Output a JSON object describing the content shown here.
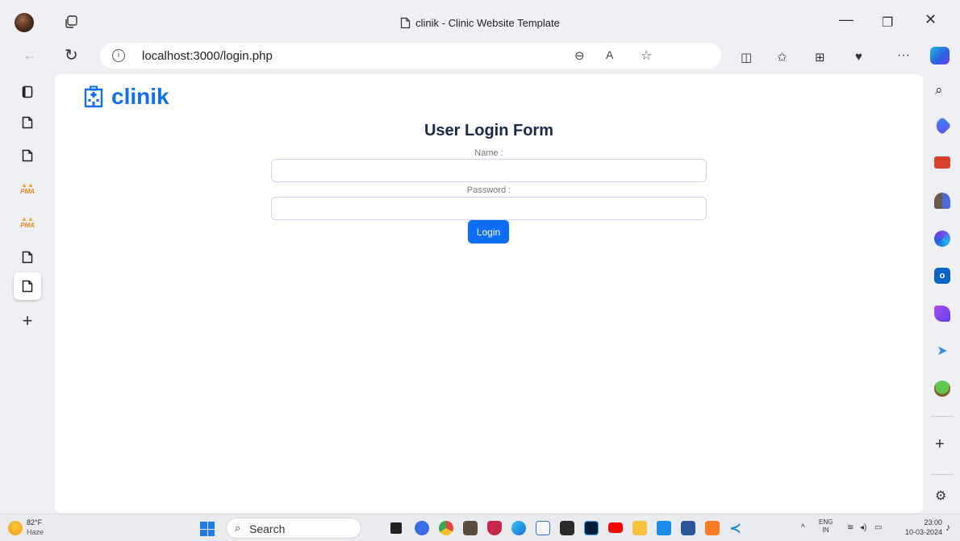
{
  "window": {
    "title": "clinik - Clinic Website Template"
  },
  "address_bar": {
    "url": "localhost:3000/login.php"
  },
  "page": {
    "brand": "clinik",
    "form_title": "User Login Form",
    "name_label": "Name :",
    "password_label": "Password :",
    "name_value": "",
    "password_value": "",
    "login_button": "Login"
  },
  "vertical_tabs": [
    {
      "icon": "page-icon"
    },
    {
      "icon": "page-icon"
    },
    {
      "icon": "phpmyadmin-icon",
      "label": "PMA"
    },
    {
      "icon": "phpmyadmin-icon",
      "label": "PMA"
    },
    {
      "icon": "page-icon"
    },
    {
      "icon": "page-icon",
      "active": true
    }
  ],
  "taskbar": {
    "weather_temp": "82°F",
    "weather_condition": "Haze",
    "search_label": "Search",
    "language_line1": "ENG",
    "language_line2": "IN",
    "time": "23:00",
    "date": "10-03-2024"
  },
  "colors": {
    "brand_blue": "#0d6efd",
    "form_title": "#1b2a4a",
    "browser_chrome": "#eef0f4"
  }
}
